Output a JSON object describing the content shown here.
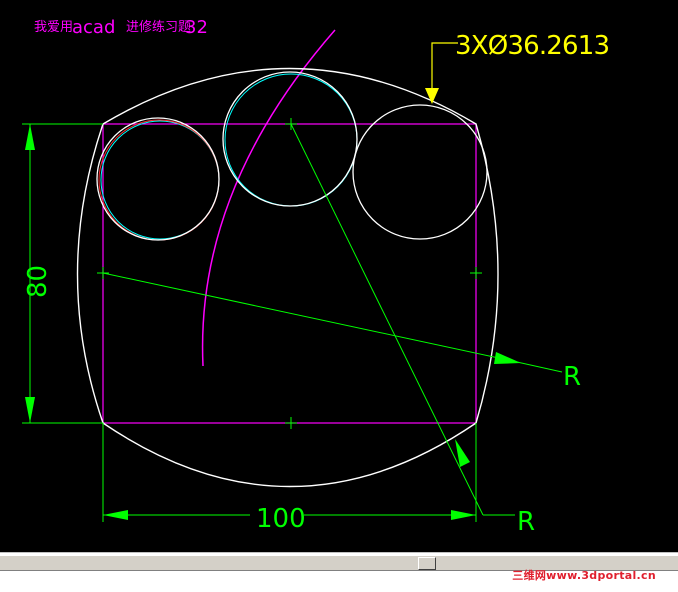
{
  "title": {
    "prefix": "我爱用",
    "app": "acad",
    "suffix": "进修练习题",
    "num": "32"
  },
  "dims": {
    "circles_callout": "3XØ36.2613",
    "height": "80",
    "width": "100",
    "radius_label_1": "R",
    "radius_label_2": "R"
  },
  "watermark": "三维网www.3dportal.cn",
  "colors": {
    "background": "#000000",
    "geometry": "#ffffff",
    "construction": "#ff00ff",
    "dimension": "#00ff00",
    "callout": "#ffff00",
    "title": "#ff00ff"
  }
}
